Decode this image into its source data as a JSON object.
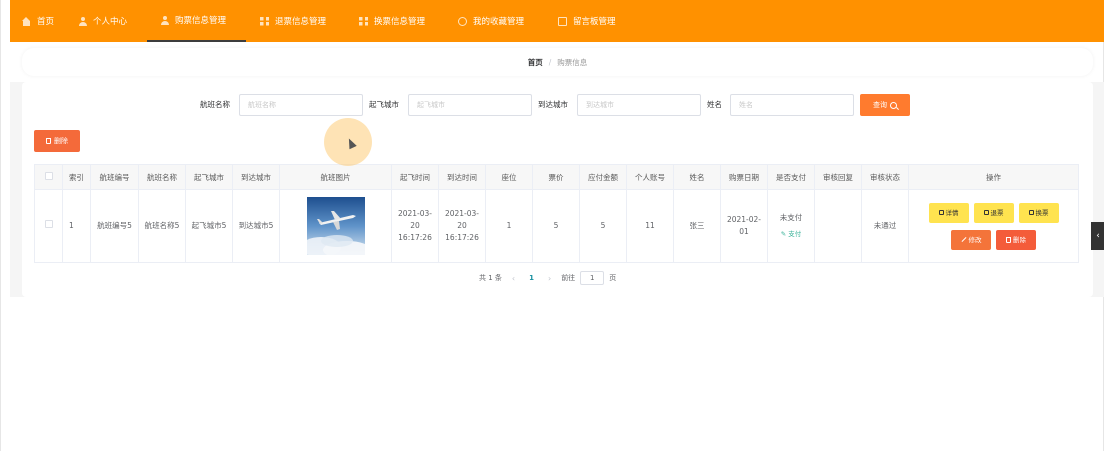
{
  "nav": {
    "items": [
      {
        "label": "首页",
        "icon": "home-icon"
      },
      {
        "label": "个人中心",
        "icon": "user-icon"
      },
      {
        "label": "购票信息管理",
        "icon": "user-icon",
        "active": true
      },
      {
        "label": "退票信息管理",
        "icon": "grid-icon"
      },
      {
        "label": "换票信息管理",
        "icon": "grid-icon"
      },
      {
        "label": "我的收藏管理",
        "icon": "clock-icon"
      },
      {
        "label": "留言板管理",
        "icon": "doc-icon"
      }
    ],
    "color": "#ff9100"
  },
  "breadcrumb": {
    "home": "首页",
    "separator": "/",
    "current": "购票信息"
  },
  "search": {
    "fields": [
      {
        "label": "航班名称",
        "placeholder": "航班名称"
      },
      {
        "label": "起飞城市",
        "placeholder": "起飞城市"
      },
      {
        "label": "到达城市",
        "placeholder": "到达城市"
      },
      {
        "label": "姓名",
        "placeholder": "姓名"
      }
    ],
    "button_label": "查询"
  },
  "toolbar": {
    "delete_label": "删除"
  },
  "table": {
    "columns": [
      "索引",
      "航班编号",
      "航班名称",
      "起飞城市",
      "到达城市",
      "航班图片",
      "起飞时间",
      "到达时间",
      "座位",
      "票价",
      "应付金额",
      "个人账号",
      "姓名",
      "购票日期",
      "是否支付",
      "审核回复",
      "审核状态",
      "操作"
    ],
    "rows": [
      {
        "index": "1",
        "flight_no": "航班编号5",
        "flight_name": "航班名称5",
        "from_city": "起飞城市5",
        "to_city": "到达城市5",
        "depart_time": "2021-03-20 16:17:26",
        "arrive_time": "2021-03-20 16:17:26",
        "seat": "1",
        "price": "5",
        "amount": "5",
        "account": "11",
        "name": "张三",
        "purchase_date": "2021-02-01",
        "paid": "未支付",
        "pay_link": "支付",
        "review_reply": "",
        "review_status": "未通过",
        "actions": {
          "detail": "详情",
          "refund": "退票",
          "change": "换票",
          "edit": "修改",
          "delete": "删除"
        }
      }
    ]
  },
  "pagination": {
    "total": "共 1 条",
    "prev": "‹",
    "current": "1",
    "next": "›",
    "goto": "前往",
    "goto_value": "1",
    "page_unit": "页"
  },
  "side_tab": {
    "label": "‹"
  }
}
